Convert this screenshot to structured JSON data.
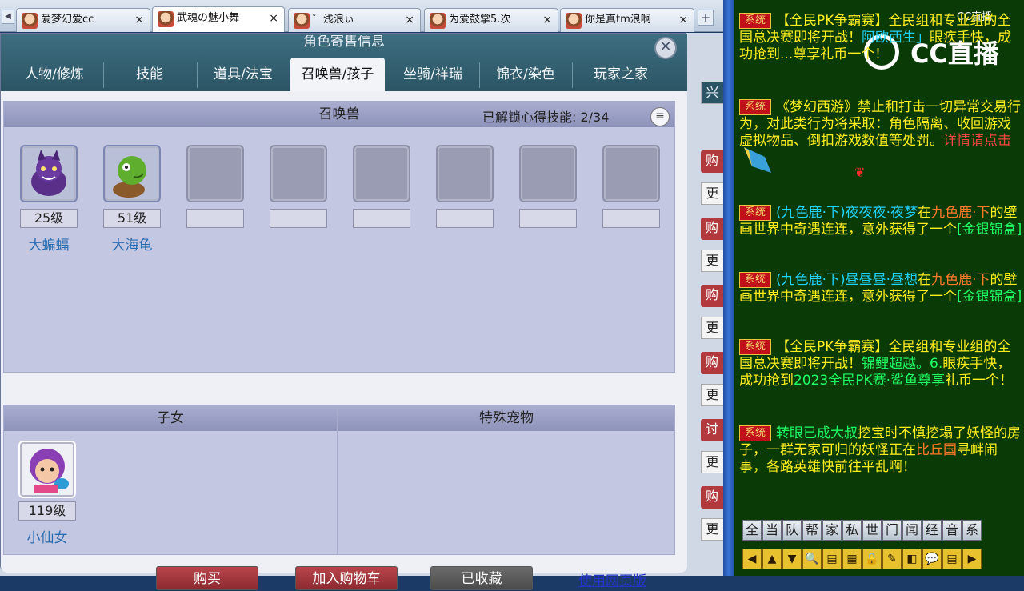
{
  "browser_tabs": [
    {
      "label": "爱梦幻爱cc",
      "close": "×"
    },
    {
      "label": "武魂の魅小舞",
      "close": "×"
    },
    {
      "label": "゜浅浪ぃ",
      "close": "×"
    },
    {
      "label": "为爱鼓掌5.次",
      "close": "×"
    },
    {
      "label": "你是真tm浪啊",
      "close": "×"
    }
  ],
  "tab_add": "+",
  "tab_arrow": "◀",
  "panel": {
    "title": "角色寄售信息",
    "close": "✕",
    "tabs": [
      "人物/修炼",
      "技能",
      "道具/法宝",
      "召唤兽/孩子",
      "坐骑/祥瑞",
      "锦衣/染色",
      "玩家之家"
    ],
    "active_tab": 3
  },
  "summon": {
    "header": "召唤兽",
    "unlock_label": "已解锁心得技能: 2/34",
    "menu_icon": "≡",
    "pets": [
      {
        "level": "25级",
        "name": "大蝙蝠"
      },
      {
        "level": "51级",
        "name": "大海龟"
      }
    ]
  },
  "children": {
    "header": "子女",
    "items": [
      {
        "level": "119级",
        "name": "小仙女"
      }
    ]
  },
  "special": {
    "header": "特殊宠物"
  },
  "buttons": {
    "buy": "购买",
    "cart": "加入购物车",
    "collected": "已收藏",
    "web": "使用网页版"
  },
  "side_buttons": [
    "兴",
    "购",
    "更",
    "购",
    "更",
    "购",
    "更",
    "购",
    "更",
    "讨",
    "更",
    "购",
    "更"
  ],
  "chat": {
    "logo": "CC直播",
    "logo_small": "CC直播",
    "badge": "系统",
    "m1_a": "【全民PK争霸赛】全民组和专业组的全国总决赛即将开战！",
    "m1_b": "阿欧西生」",
    "m1_c": "眼疾手快，成功抢到",
    "m1_d": "...尊享礼币一个！",
    "m2_a": "《梦幻西游》禁止和打击一切异常交易行为，对此类行为将采取：角色隔离、收回游戏虚拟物品、倒扣游戏数值等处罚。",
    "m2_link": "详情请点击",
    "m3_a": "(九色鹿·下)夜夜夜·夜梦",
    "m3_b": "在",
    "m3_c": "九色鹿·下",
    "m3_d": "的壁画世界中奇遇连连，意外获得了一个",
    "m3_e": "[金银锦盒]",
    "m4_a": "(九色鹿·下)昼昼昼·昼想",
    "m5_a": "【全民PK争霸赛】全民组和专业组的全国总决赛即将开战！",
    "m5_b": "锦鲤超越。6.",
    "m5_c": "眼疾手快，成功抢到",
    "m5_d": "2023全民PK赛·鲨鱼尊享",
    "m5_e": "礼币一个！",
    "m6_a": "转眼已成大叔",
    "m6_b": "挖宝时不慎挖塌了妖怪的房子，一群无家可归的妖怪正在",
    "m6_c": "比丘国",
    "m6_d": "寻衅闹事，各路英雄快前往平乱啊！",
    "tabs": [
      "全",
      "当",
      "队",
      "帮",
      "家",
      "私",
      "世",
      "门",
      "闻",
      "经",
      "音",
      "系"
    ],
    "icons": [
      "◀",
      "▲",
      "▼",
      "🔍",
      "▤",
      "▦",
      "🔒",
      "✎",
      "◧",
      "💬",
      "▤",
      "▶"
    ]
  }
}
